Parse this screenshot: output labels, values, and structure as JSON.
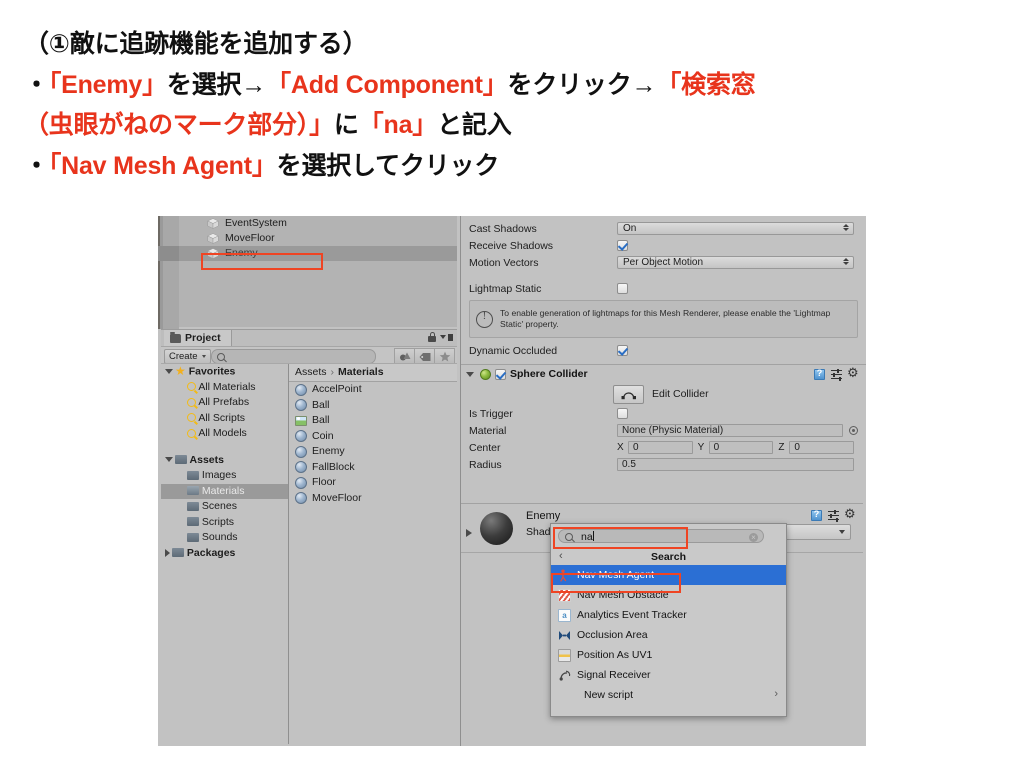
{
  "slide": {
    "lines": [
      [
        {
          "t": "（①敵に追跡機能を追加する）",
          "c": "blk"
        }
      ],
      [
        {
          "t": "・",
          "c": "blk"
        },
        {
          "t": "「Enemy」",
          "c": "red"
        },
        {
          "t": "を選択→",
          "c": "blk"
        },
        {
          "t": "「Add Component」",
          "c": "red"
        },
        {
          "t": "をクリック→",
          "c": "blk"
        },
        {
          "t": "「検索窓",
          "c": "red"
        }
      ],
      [
        {
          "t": "（虫眼がねのマーク部分）」",
          "c": "red"
        },
        {
          "t": "に",
          "c": "blk"
        },
        {
          "t": "「na」",
          "c": "red"
        },
        {
          "t": "と記入",
          "c": "blk"
        }
      ],
      [
        {
          "t": "・",
          "c": "blk"
        },
        {
          "t": "「Nav Mesh Agent」",
          "c": "red"
        },
        {
          "t": "を選択してクリック",
          "c": "blk"
        }
      ]
    ],
    "accent_color": "#e8341c",
    "text_color": "#111111"
  },
  "hierarchy": {
    "items": [
      {
        "label": "EventSystem",
        "selected": false
      },
      {
        "label": "MoveFloor",
        "selected": false
      },
      {
        "label": "Enemy",
        "selected": true
      }
    ]
  },
  "project": {
    "tab_label": "Project",
    "create_label": "Create",
    "search_placeholder": "",
    "tree": [
      {
        "label": "Favorites",
        "type": "star",
        "depth": 0,
        "expand": "down",
        "bold": true,
        "selected": false
      },
      {
        "label": "All Materials",
        "type": "search",
        "depth": 1,
        "expand": "",
        "bold": false,
        "selected": false
      },
      {
        "label": "All Prefabs",
        "type": "search",
        "depth": 1,
        "expand": "",
        "bold": false,
        "selected": false
      },
      {
        "label": "All Scripts",
        "type": "search",
        "depth": 1,
        "expand": "",
        "bold": false,
        "selected": false
      },
      {
        "label": "All Models",
        "type": "search",
        "depth": 1,
        "expand": "",
        "bold": false,
        "selected": false
      },
      {
        "label": "",
        "type": "spacer",
        "depth": 0,
        "expand": "",
        "bold": false,
        "selected": false
      },
      {
        "label": "Assets",
        "type": "folder",
        "depth": 0,
        "expand": "down",
        "bold": true,
        "selected": false
      },
      {
        "label": "Images",
        "type": "folder",
        "depth": 1,
        "expand": "",
        "bold": false,
        "selected": false
      },
      {
        "label": "Materials",
        "type": "folder-open",
        "depth": 1,
        "expand": "",
        "bold": false,
        "selected": true
      },
      {
        "label": "Scenes",
        "type": "folder",
        "depth": 1,
        "expand": "",
        "bold": false,
        "selected": false
      },
      {
        "label": "Scripts",
        "type": "folder",
        "depth": 1,
        "expand": "",
        "bold": false,
        "selected": false
      },
      {
        "label": "Sounds",
        "type": "folder",
        "depth": 1,
        "expand": "",
        "bold": false,
        "selected": false
      },
      {
        "label": "Packages",
        "type": "folder",
        "depth": 0,
        "expand": "right",
        "bold": true,
        "selected": false
      }
    ],
    "breadcrumb": {
      "root": "Assets",
      "sep": "›",
      "current": "Materials"
    },
    "assets": [
      {
        "label": "AccelPoint",
        "icon": "material-ball"
      },
      {
        "label": "Ball",
        "icon": "material-ball"
      },
      {
        "label": "Ball",
        "icon": "texture-image"
      },
      {
        "label": "Coin",
        "icon": "material-ball"
      },
      {
        "label": "Enemy",
        "icon": "material-ball"
      },
      {
        "label": "FallBlock",
        "icon": "material-ball"
      },
      {
        "label": "Floor",
        "icon": "material-ball"
      },
      {
        "label": "MoveFloor",
        "icon": "material-ball"
      }
    ]
  },
  "inspector": {
    "mesh_renderer_rows": [
      {
        "label": "Cast Shadows",
        "kind": "popup",
        "value": "On"
      },
      {
        "label": "Receive Shadows",
        "kind": "checkbox",
        "value": "checked"
      },
      {
        "label": "Motion Vectors",
        "kind": "popup",
        "value": "Per Object Motion"
      },
      {
        "label": "Lightmap Static",
        "kind": "checkbox",
        "value": "unchecked"
      }
    ],
    "help_text": "To enable generation of lightmaps for this Mesh Renderer, please enable the 'Lightmap Static' property.",
    "dynamic_occluded": {
      "label": "Dynamic Occluded",
      "value": "checked"
    },
    "sphere_collider": {
      "title": "Sphere Collider",
      "enabled": "checked",
      "edit_collider_label": "Edit Collider",
      "is_trigger": {
        "label": "Is Trigger",
        "value": "unchecked"
      },
      "material": {
        "label": "Material",
        "value": "None (Physic Material)"
      },
      "center": {
        "label": "Center",
        "x_axis": "X",
        "x": "0",
        "y_axis": "Y",
        "y": "0",
        "z_axis": "Z",
        "z": "0"
      },
      "radius": {
        "label": "Radius",
        "value": "0.5"
      }
    },
    "material_section": {
      "name": "Enemy",
      "shader_label": "Shader",
      "shader_value": ""
    }
  },
  "add_component": {
    "search_value": "na",
    "search_placeholder": "Search",
    "header_title": "Search",
    "back_arrow": "‹",
    "results": [
      {
        "label": "Nav Mesh Agent",
        "icon": "nav-mesh-agent-icon",
        "selected": true,
        "submenu": false
      },
      {
        "label": "Nav Mesh Obstacle",
        "icon": "nav-mesh-obstacle-icon",
        "selected": false,
        "submenu": false
      },
      {
        "label": "Analytics Event Tracker",
        "icon": "analytics-event-tracker-icon",
        "selected": false,
        "submenu": false
      },
      {
        "label": "Occlusion Area",
        "icon": "occlusion-area-icon",
        "selected": false,
        "submenu": false
      },
      {
        "label": "Position As UV1",
        "icon": "position-as-uv1-icon",
        "selected": false,
        "submenu": false
      },
      {
        "label": "Signal Receiver",
        "icon": "signal-receiver-icon",
        "selected": false,
        "submenu": false
      },
      {
        "label": "New script",
        "icon": "",
        "selected": false,
        "submenu": true
      }
    ],
    "submenu_chevron": "›",
    "highlight_color": "#2b6fd4",
    "annotation_color": "#ef4423"
  }
}
